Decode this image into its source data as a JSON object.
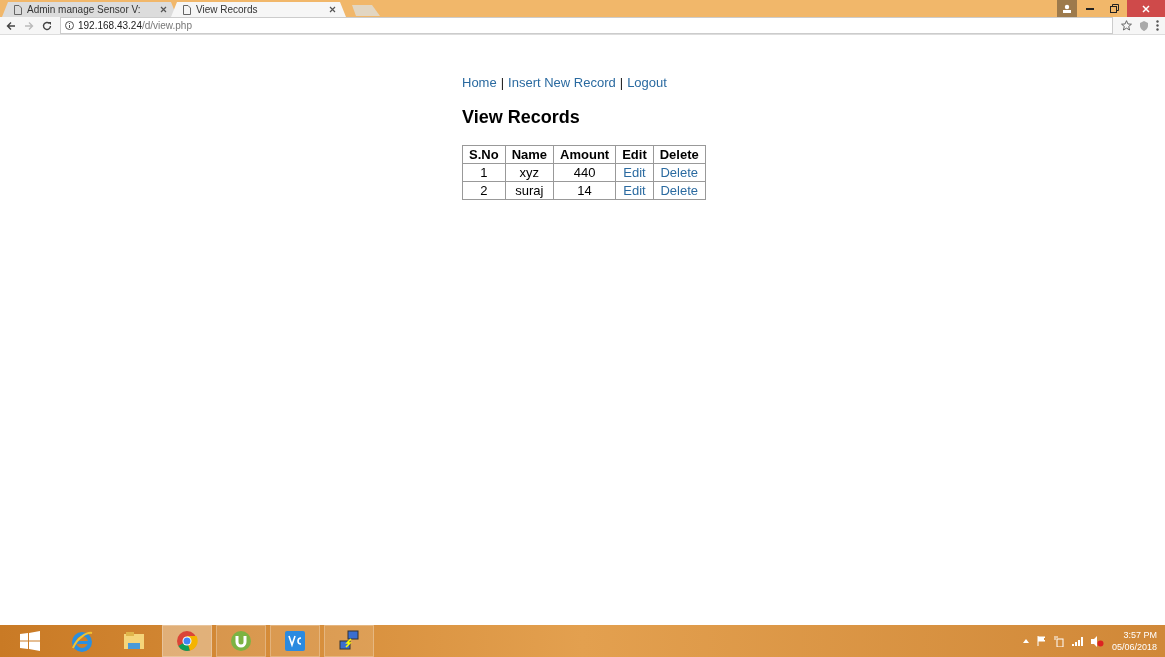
{
  "browser": {
    "tabs": [
      {
        "title": "Admin manage Sensor V:",
        "selected": false
      },
      {
        "title": "View Records",
        "selected": true
      }
    ],
    "address": {
      "host": "192.168.43.24",
      "path": "/d/view.php"
    }
  },
  "page": {
    "nav": [
      {
        "label": "Home"
      },
      {
        "label": "Insert New Record"
      },
      {
        "label": "Logout"
      }
    ],
    "separator": "|",
    "heading": "View Records",
    "table": {
      "columns": [
        {
          "label": "S.No",
          "kind": "text"
        },
        {
          "label": "Name",
          "kind": "text"
        },
        {
          "label": "Amount",
          "kind": "text"
        },
        {
          "label": "Edit",
          "kind": "link"
        },
        {
          "label": "Delete",
          "kind": "link"
        }
      ],
      "rows": [
        [
          "1",
          "xyz",
          "440",
          "Edit",
          "Delete"
        ],
        [
          "2",
          "suraj",
          "14",
          "Edit",
          "Delete"
        ]
      ]
    }
  },
  "taskbar": {
    "apps": [
      {
        "kind": "start"
      },
      {
        "kind": "ie"
      },
      {
        "kind": "explorer"
      },
      {
        "kind": "chrome",
        "selected": true
      },
      {
        "kind": "utorrent",
        "selected": false
      },
      {
        "kind": "vnc",
        "selected": false
      },
      {
        "kind": "network",
        "selected": false
      }
    ],
    "time": "3:57 PM",
    "date": "05/06/2018"
  }
}
